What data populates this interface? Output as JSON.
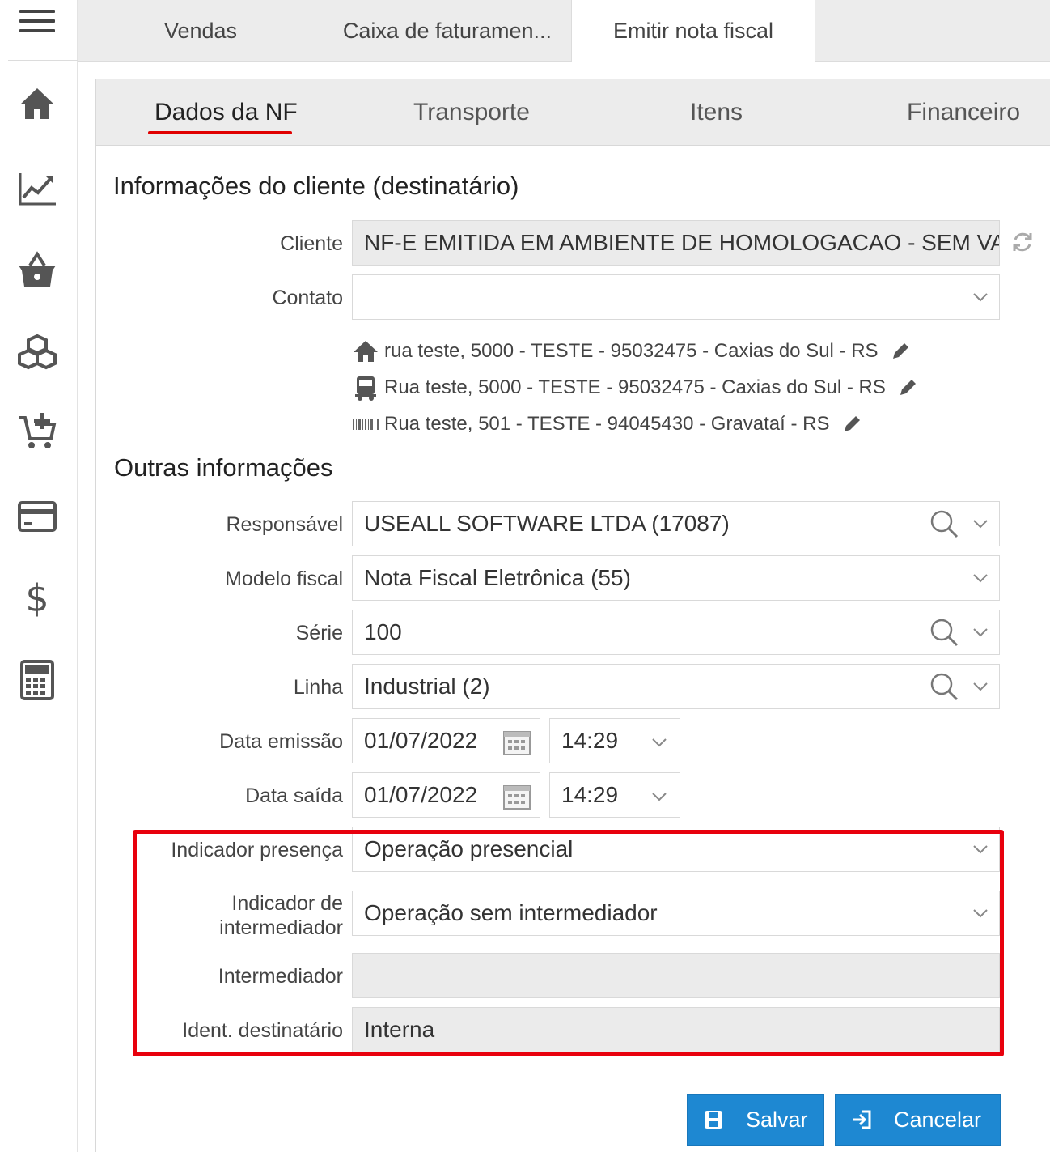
{
  "rail": {
    "items": [
      {
        "name": "home-icon"
      },
      {
        "name": "chart-line-icon"
      },
      {
        "name": "basket-icon"
      },
      {
        "name": "boxes-icon"
      },
      {
        "name": "cart-plus-icon"
      },
      {
        "name": "credit-card-icon"
      },
      {
        "name": "dollar-icon"
      },
      {
        "name": "calculator-icon"
      }
    ]
  },
  "top_tabs": [
    "Vendas",
    "Caixa de faturamen...",
    "Emitir nota fiscal"
  ],
  "sub_tabs": [
    "Dados da NF",
    "Transporte",
    "Itens",
    "Financeiro"
  ],
  "cliente_section": {
    "title": "Informações do cliente (destinatário)",
    "cliente_label": "Cliente",
    "cliente_value": "NF-E EMITIDA EM AMBIENTE DE HOMOLOGACAO - SEM VALOR FISCAL",
    "contato_label": "Contato",
    "contato_value": "",
    "addresses": [
      {
        "icon": "house-icon",
        "text": "rua teste, 5000 - TESTE - 95032475 - Caxias do Sul - RS"
      },
      {
        "icon": "truck-icon",
        "text": "Rua teste, 5000 - TESTE - 95032475 - Caxias do Sul - RS"
      },
      {
        "icon": "barcode-icon",
        "text": "Rua teste, 501 - TESTE - 94045430 - Gravataí - RS"
      }
    ]
  },
  "outras_section": {
    "title": "Outras informações",
    "responsavel_label": "Responsável",
    "responsavel_value": "USEALL SOFTWARE LTDA (17087)",
    "modelo_label": "Modelo fiscal",
    "modelo_value": "Nota Fiscal Eletrônica (55)",
    "serie_label": "Série",
    "serie_value": "100",
    "linha_label": "Linha",
    "linha_value": "Industrial (2)",
    "data_emissao_label": "Data emissão",
    "data_emissao_value": "01/07/2022",
    "hora_emissao_value": "14:29",
    "data_saida_label": "Data saída",
    "data_saida_value": "01/07/2022",
    "hora_saida_value": "14:29",
    "ind_presenca_label": "Indicador presença",
    "ind_presenca_value": "Operação presencial",
    "ind_intermediador_label_1": "Indicador de",
    "ind_intermediador_label_2": "intermediador",
    "ind_intermediador_value": "Operação sem intermediador",
    "intermediador_label": "Intermediador",
    "intermediador_value": "",
    "ident_dest_label": "Ident. destinatário",
    "ident_dest_value": "Interna"
  },
  "buttons": {
    "save": "Salvar",
    "cancel": "Cancelar"
  },
  "colors": {
    "accent": "#1e88d2",
    "highlight": "#e8000d",
    "underline": "#e00000"
  }
}
